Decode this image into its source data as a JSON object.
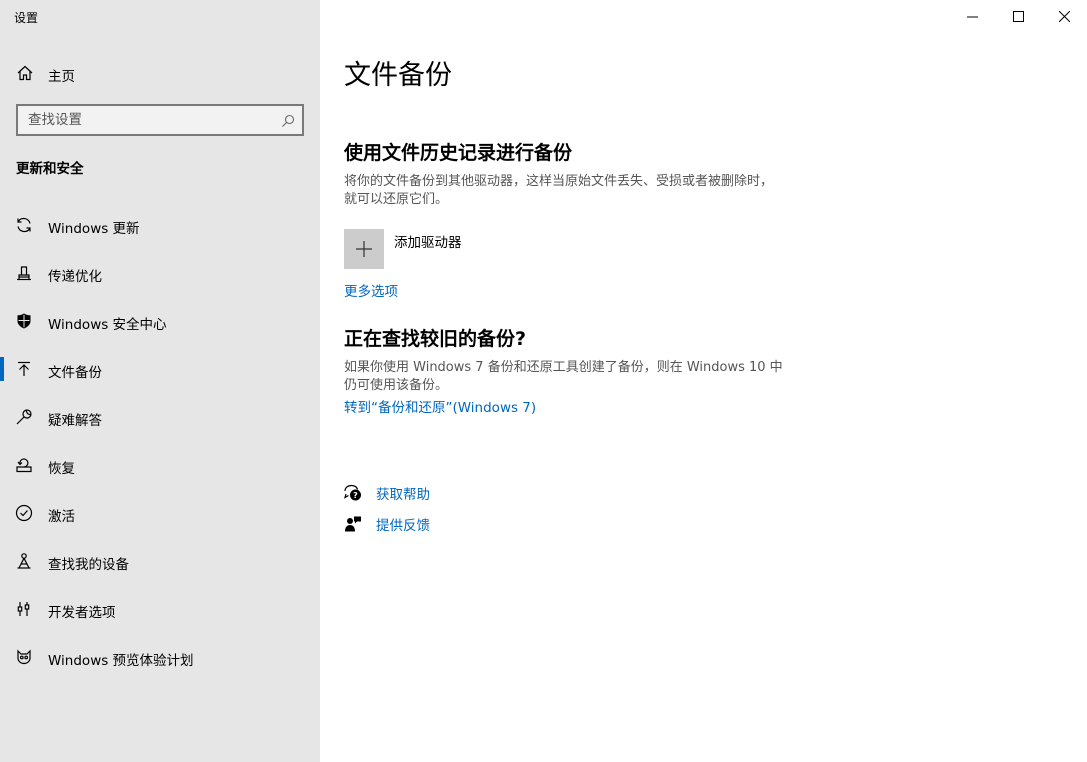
{
  "window": {
    "title": "设置"
  },
  "sidebar": {
    "home_label": "主页",
    "search_placeholder": "查找设置",
    "section_heading": "更新和安全",
    "items": [
      {
        "label": "Windows 更新",
        "icon": "refresh-icon",
        "active": false
      },
      {
        "label": "传递优化",
        "icon": "delivery-optimization-icon",
        "active": false
      },
      {
        "label": "Windows 安全中心",
        "icon": "shield-icon",
        "active": false
      },
      {
        "label": "文件备份",
        "icon": "backup-arrow-icon",
        "active": true
      },
      {
        "label": "疑难解答",
        "icon": "wrench-icon",
        "active": false
      },
      {
        "label": "恢复",
        "icon": "recovery-icon",
        "active": false
      },
      {
        "label": "激活",
        "icon": "check-circle-icon",
        "active": false
      },
      {
        "label": "查找我的设备",
        "icon": "find-device-icon",
        "active": false
      },
      {
        "label": "开发者选项",
        "icon": "developer-icon",
        "active": false
      },
      {
        "label": "Windows 预览体验计划",
        "icon": "insider-cat-icon",
        "active": false
      }
    ]
  },
  "main": {
    "page_title": "文件备份",
    "file_history": {
      "heading": "使用文件历史记录进行备份",
      "description": "将你的文件备份到其他驱动器，这样当原始文件丢失、受损或者被删除时，就可以还原它们。",
      "add_drive_label": "添加驱动器",
      "more_options_link": "更多选项"
    },
    "older_backup": {
      "heading": "正在查找较旧的备份?",
      "description": "如果你使用 Windows 7 备份和还原工具创建了备份，则在 Windows 10 中仍可使用该备份。",
      "link": "转到“备份和还原”(Windows 7)"
    },
    "help": {
      "get_help": "获取帮助",
      "feedback": "提供反馈"
    }
  },
  "colors": {
    "sidebar_bg": "#e6e6e6",
    "accent": "#0067c0",
    "add_drive_bg": "#cccccc"
  }
}
